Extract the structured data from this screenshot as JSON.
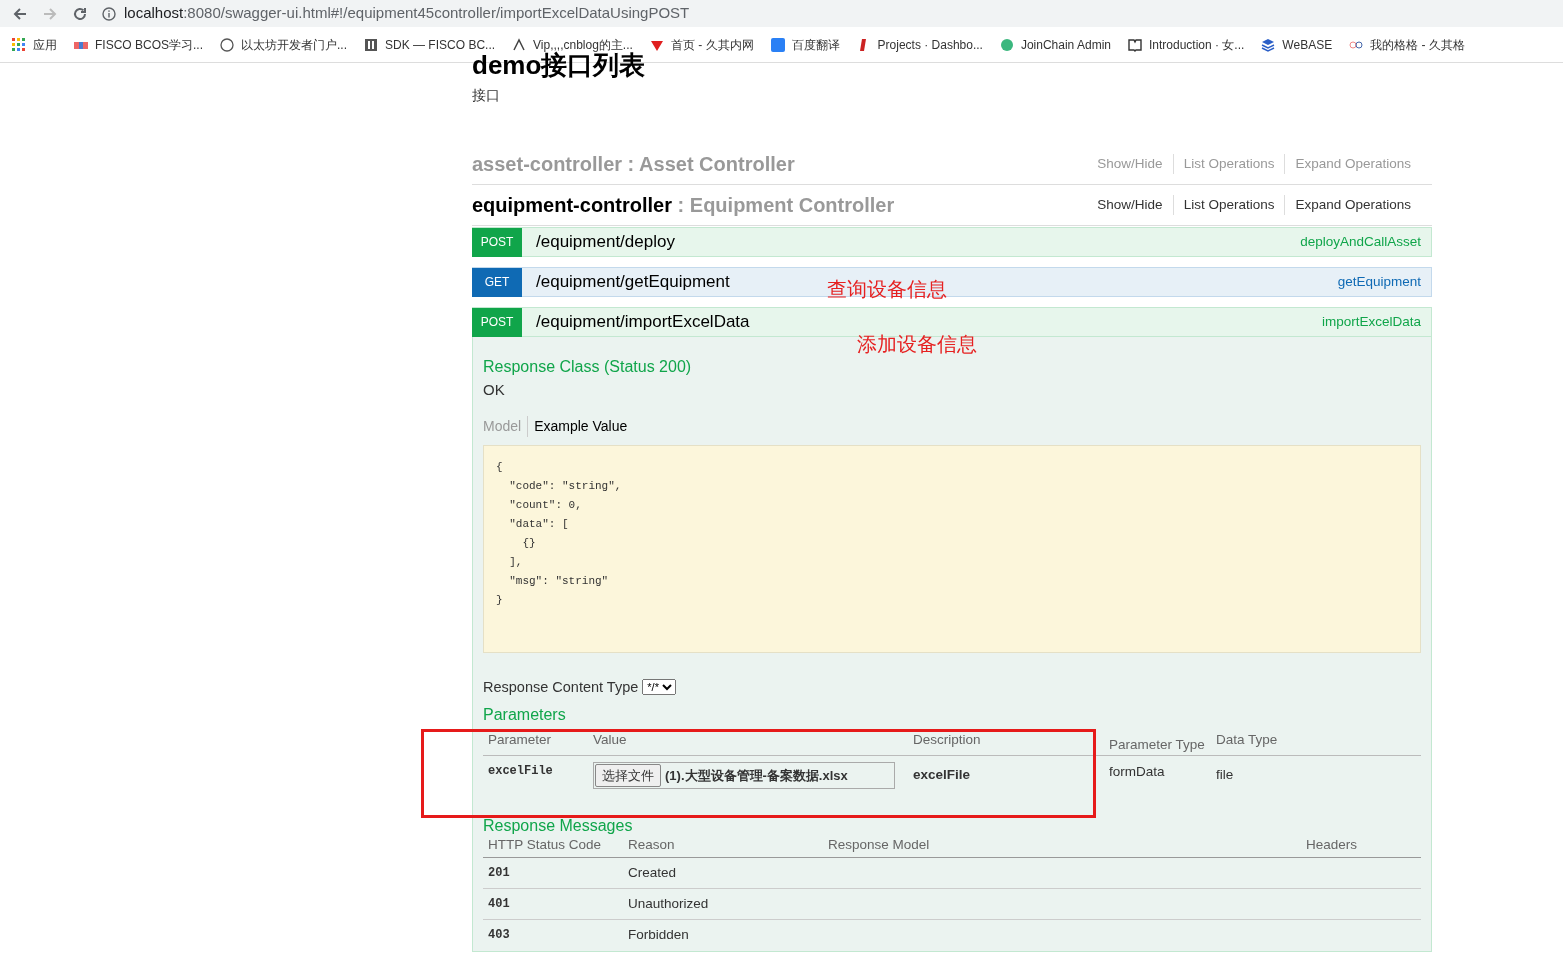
{
  "browser": {
    "url_host": "localhost",
    "url_rest": ":8080/swagger-ui.html#!/equipment45controller/importExcelDataUsingPOST",
    "bookmarks": [
      "应用",
      "FISCO BCOS学习...",
      "以太坊开发者门户...",
      "SDK — FISCO BC...",
      "Vip,,,,cnblog的主...",
      "首页 - 久其内网",
      "百度翻译",
      "Projects · Dashbo...",
      "JoinChain Admin",
      "Introduction · 女...",
      "WeBASE",
      "我的格格 - 久其格"
    ]
  },
  "page": {
    "title": "demo接口列表",
    "subtitle": "接口"
  },
  "controllers": [
    {
      "name": "asset-controller",
      "separator": ":",
      "description": "Asset Controller",
      "expanded": false,
      "links": [
        "Show/Hide",
        "List Operations",
        "Expand Operations"
      ]
    },
    {
      "name": "equipment-controller",
      "separator": ":",
      "description": "Equipment Controller",
      "expanded": true,
      "links": [
        "Show/Hide",
        "List Operations",
        "Expand Operations"
      ]
    }
  ],
  "operations": [
    {
      "kind": "post",
      "method": "POST",
      "path": "/equipment/deploy",
      "nickname": "deployAndCallAsset",
      "expanded": false
    },
    {
      "kind": "get",
      "method": "GET",
      "path": "/equipment/getEquipment",
      "nickname": "getEquipment",
      "expanded": false,
      "annotation": "查询设备信息"
    },
    {
      "kind": "post",
      "method": "POST",
      "path": "/equipment/importExcelData",
      "nickname": "importExcelData",
      "expanded": true,
      "annotation": "添加设备信息"
    }
  ],
  "detail": {
    "response_class_title": "Response Class (Status 200)",
    "response_class_value": "OK",
    "model_tabs": [
      {
        "label": "Model",
        "selected": false
      },
      {
        "label": "Example Value",
        "selected": true
      }
    ],
    "example_lines": [
      "{",
      "  \"code\": \"string\",",
      "  \"count\": 0,",
      "  \"data\": [",
      "    {}",
      "  ],",
      "  \"msg\": \"string\"",
      "}"
    ],
    "content_type_label": "Response Content Type",
    "content_type_value": "*/*",
    "parameters_title": "Parameters",
    "parameter_columns": [
      "Parameter",
      "Value",
      "Description",
      "Parameter Type",
      "Data Type"
    ],
    "parameters": [
      {
        "name": "excelFile",
        "button": "选择文件",
        "file": "(1).大型设备管理-备案数据.xlsx",
        "description": "excelFile",
        "param_type": "formData",
        "data_type": "file"
      }
    ],
    "responses_title": "Response Messages",
    "response_columns": [
      "HTTP Status Code",
      "Reason",
      "Response Model",
      "Headers"
    ],
    "responses": [
      {
        "code": "201",
        "reason": "Created"
      },
      {
        "code": "401",
        "reason": "Unauthorized"
      },
      {
        "code": "403",
        "reason": "Forbidden"
      }
    ]
  }
}
